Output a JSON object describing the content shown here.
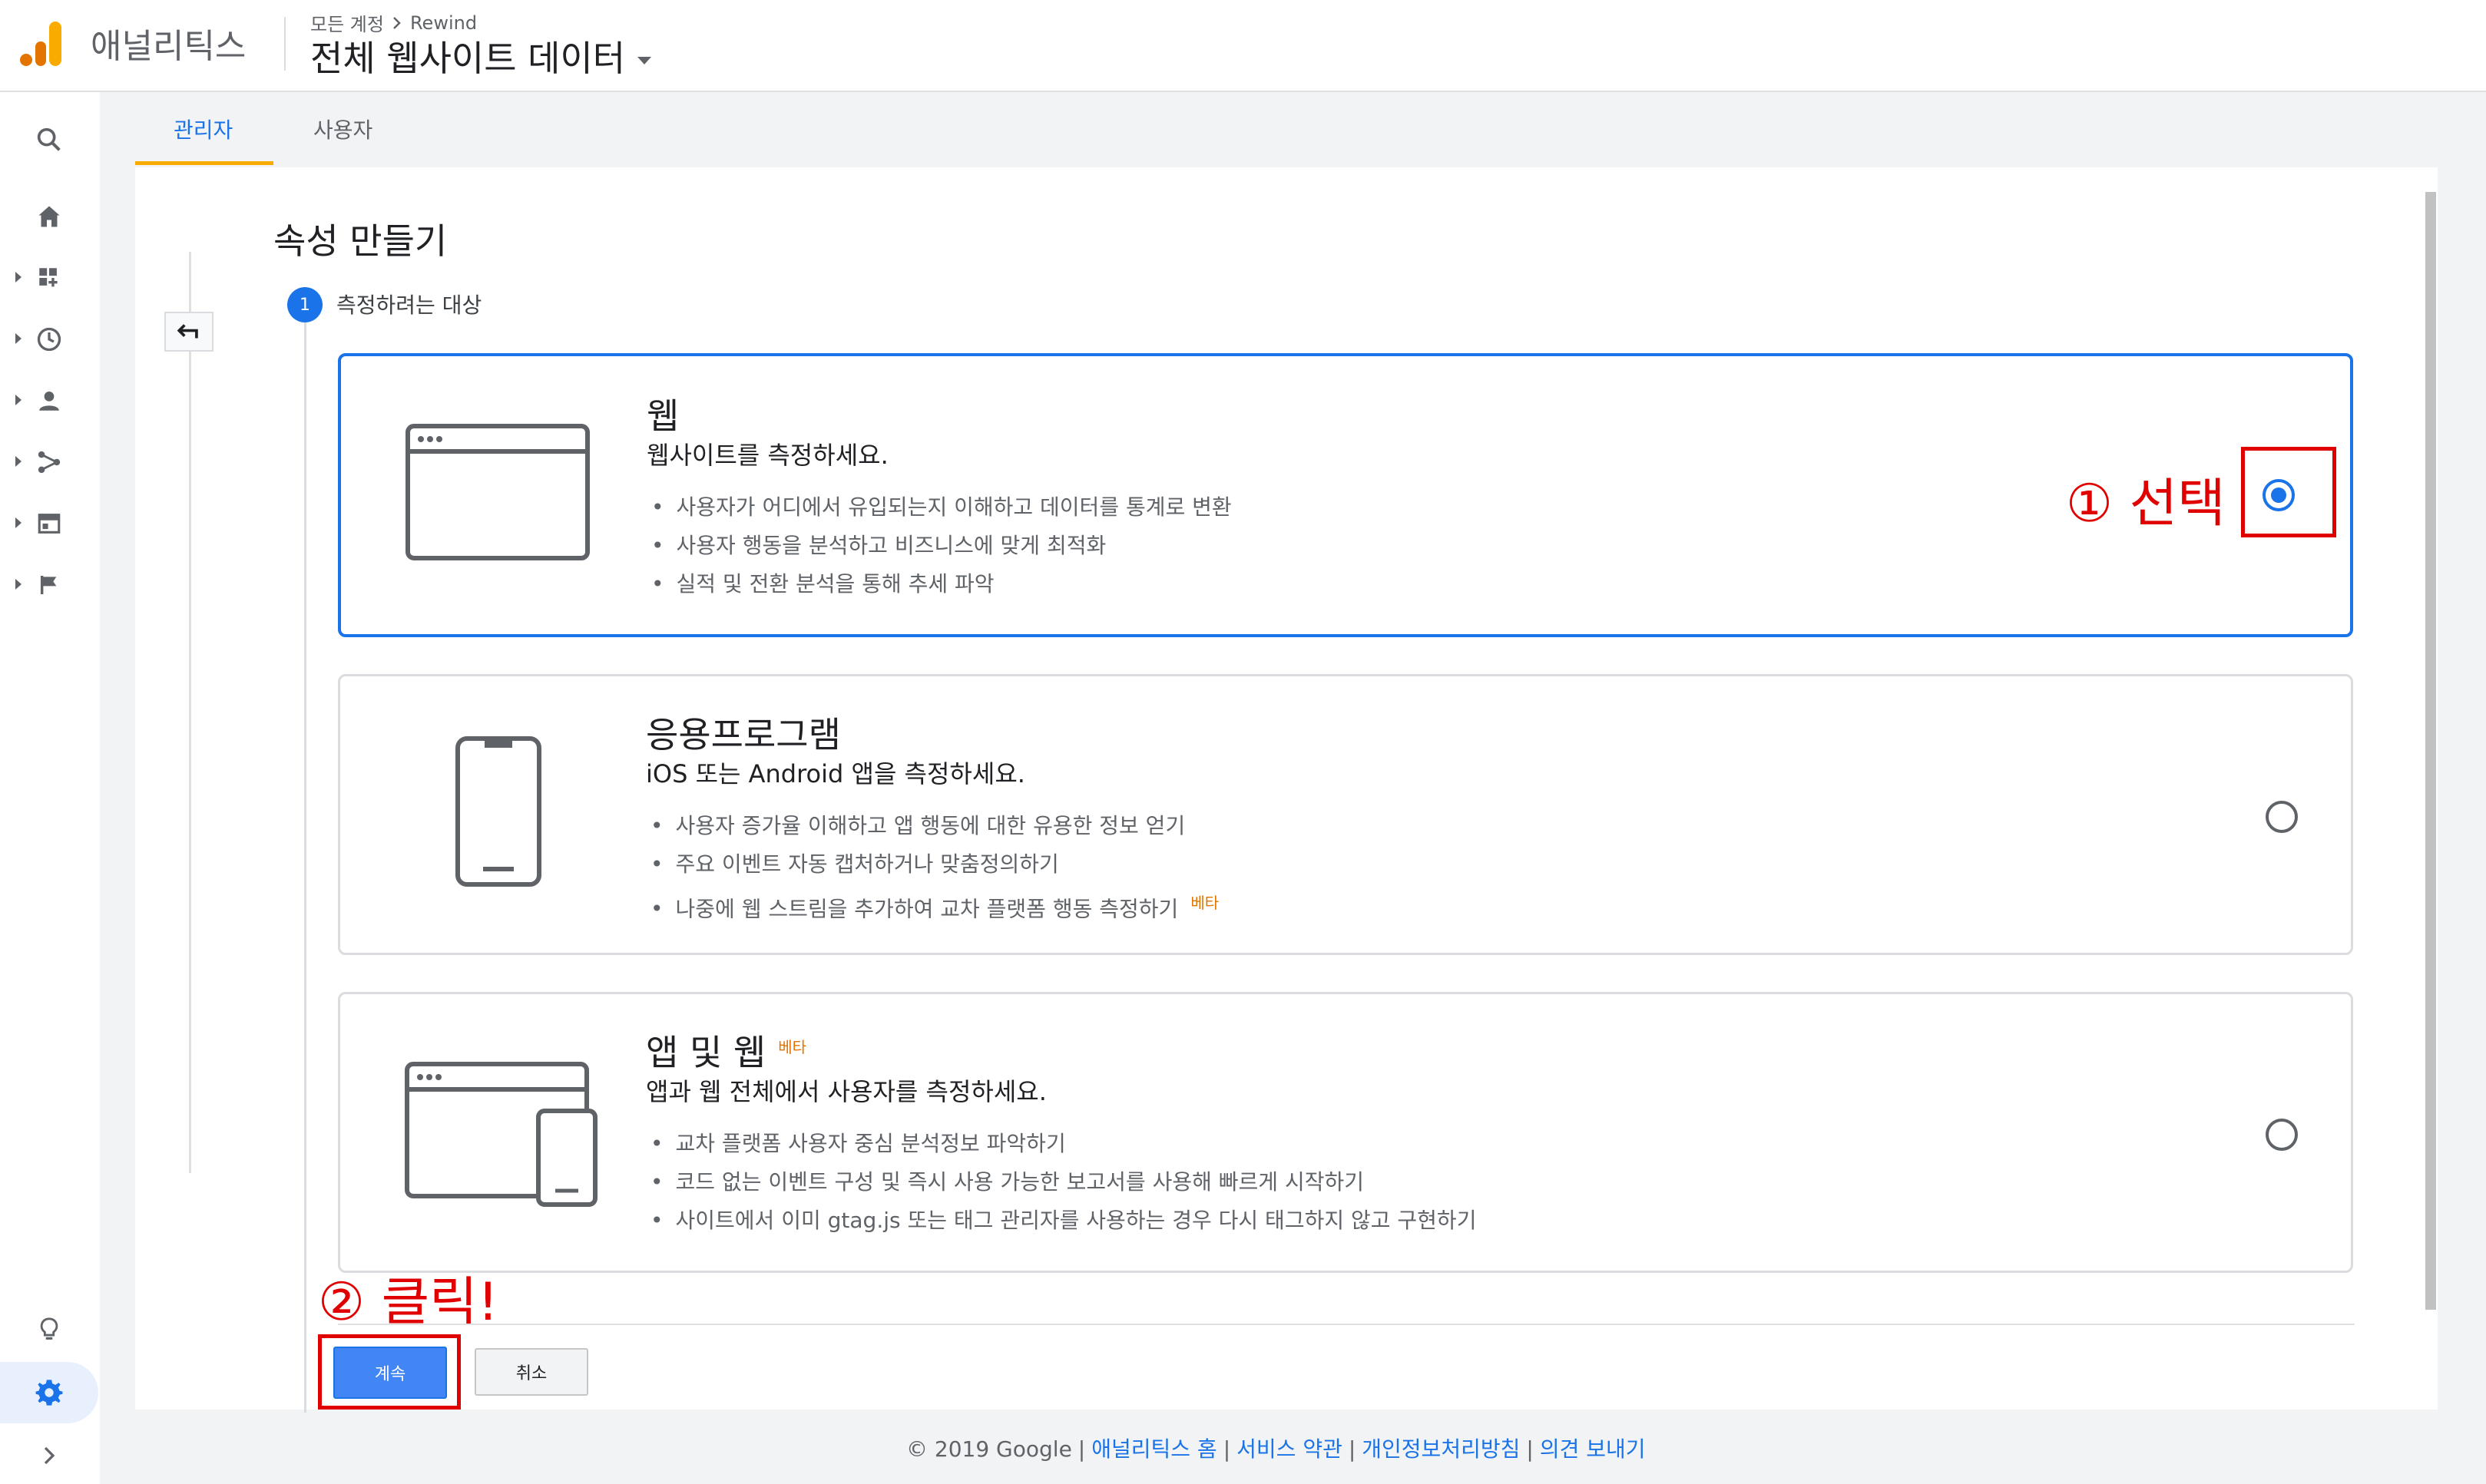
{
  "header": {
    "app_name": "애널리틱스",
    "breadcrumb": [
      "모든 계정",
      "Rewind"
    ],
    "view_title": "전체 웹사이트 데이터"
  },
  "tabs": [
    {
      "label": "관리자",
      "active": true
    },
    {
      "label": "사용자",
      "active": false
    }
  ],
  "page": {
    "title": "속성 만들기",
    "step_number": "1",
    "step_label": "측정하려는 대상"
  },
  "options": [
    {
      "title": "웹",
      "subtitle": "웹사이트를 측정하세요.",
      "bullets": [
        "사용자가 어디에서 유입되는지 이해하고 데이터를 통계로 변환",
        "사용자 행동을 분석하고 비즈니스에 맞게 최적화",
        "실적 및 전환 분석을 통해 추세 파악"
      ],
      "selected": true
    },
    {
      "title": "응용프로그램",
      "subtitle": "iOS 또는 Android 앱을 측정하세요.",
      "bullets": [
        "사용자 증가율 이해하고 앱 행동에 대한 유용한 정보 얻기",
        "주요 이벤트 자동 캡처하거나 맞춤정의하기",
        "나중에 웹 스트림을 추가하여 교차 플랫폼 행동 측정하기"
      ],
      "bullet_badge": "베타",
      "selected": false
    },
    {
      "title": "앱 및 웹",
      "title_badge": "베타",
      "subtitle": "앱과 웹 전체에서 사용자를 측정하세요.",
      "bullets": [
        "교차 플랫폼 사용자 중심 분석정보 파악하기",
        "코드 없는 이벤트 구성 및 즉시 사용 가능한 보고서를 사용해 빠르게 시작하기",
        "사이트에서 이미 gtag.js 또는 태그 관리자를 사용하는 경우 다시 태그하지 않고 구현하기"
      ],
      "selected": false
    }
  ],
  "annotations": {
    "select": "① 선택",
    "click": "② 클릭!"
  },
  "buttons": {
    "continue": "계속",
    "cancel": "취소"
  },
  "footer": {
    "copyright": "© 2019 Google",
    "links": [
      "애널리틱스 홈",
      "서비스 약관",
      "개인정보처리방침",
      "의견 보내기"
    ]
  },
  "colors": {
    "accent": "#1a73e8",
    "annotation": "#e00000",
    "logo_orange": "#e37400",
    "logo_yellow": "#f9ab00",
    "beta": "#e37400"
  },
  "icons": {
    "nav": [
      "search-icon",
      "home-icon",
      "dashboard-icon",
      "clock-icon",
      "person-icon",
      "acquisition-icon",
      "behavior-icon",
      "flag-icon",
      "lightbulb-icon",
      "gear-icon",
      "chevron-right-icon"
    ]
  }
}
